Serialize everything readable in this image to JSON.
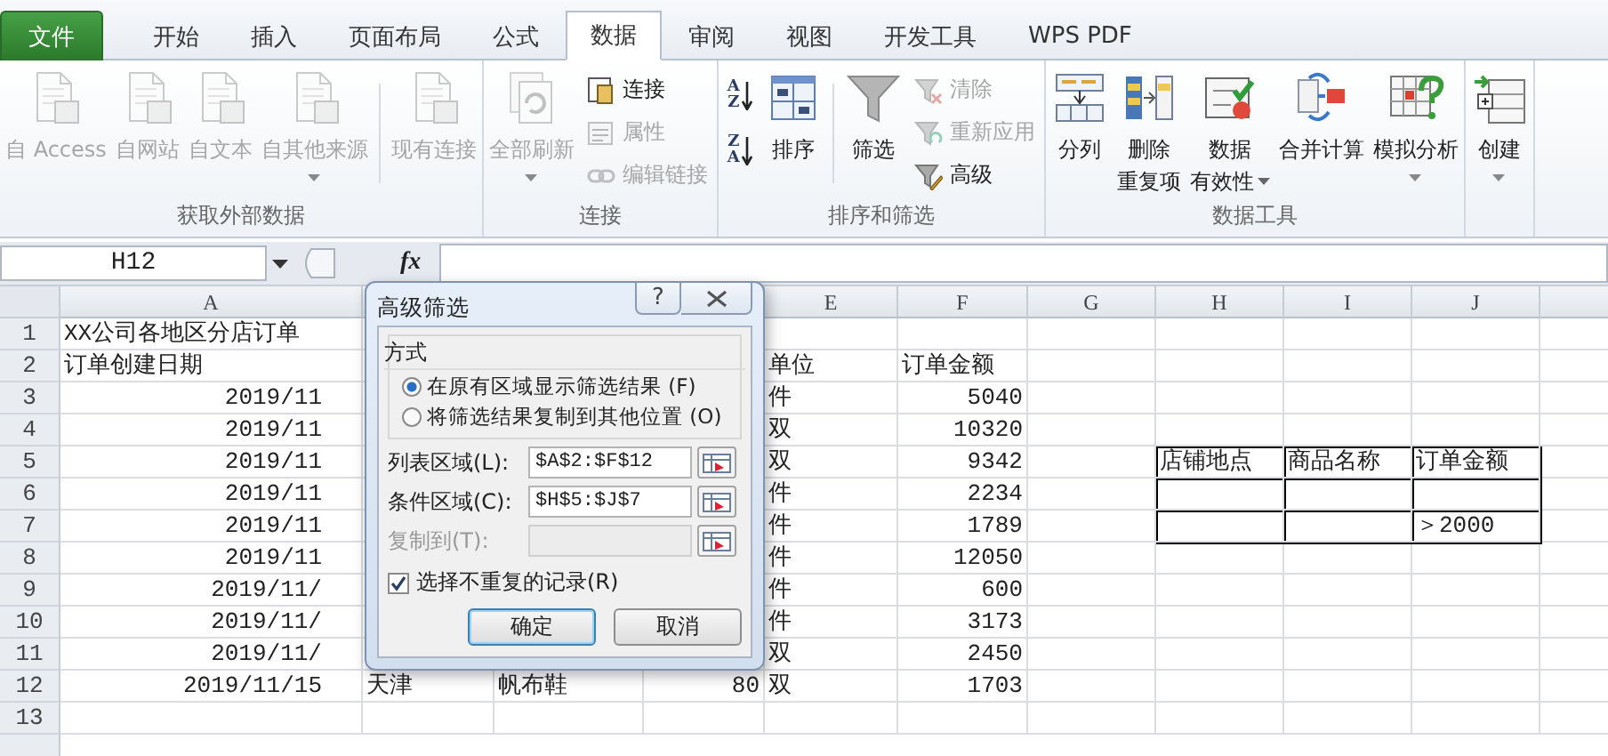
{
  "tabs": [
    {
      "label": "文件",
      "kind": "file",
      "selected": false
    },
    {
      "label": "开始",
      "kind": "tab",
      "selected": false
    },
    {
      "label": "插入",
      "kind": "tab",
      "selected": false
    },
    {
      "label": "页面布局",
      "kind": "tab",
      "selected": false
    },
    {
      "label": "公式",
      "kind": "tab",
      "selected": false
    },
    {
      "label": "数据",
      "kind": "tab",
      "selected": true
    },
    {
      "label": "审阅",
      "kind": "tab",
      "selected": false
    },
    {
      "label": "视图",
      "kind": "tab",
      "selected": false
    },
    {
      "label": "开发工具",
      "kind": "tab",
      "selected": false
    },
    {
      "label": "WPS PDF",
      "kind": "tab",
      "selected": false
    }
  ],
  "ribbon": {
    "groups": [
      {
        "title": "获取外部数据",
        "columns": [
          {
            "kind": "large",
            "lines": [
              "自 Access"
            ],
            "disabled": true,
            "dropdown": false
          },
          {
            "kind": "large",
            "lines": [
              "自网站"
            ],
            "disabled": true,
            "dropdown": false
          },
          {
            "kind": "large",
            "lines": [
              "自文本"
            ],
            "disabled": true,
            "dropdown": false
          },
          {
            "kind": "large",
            "lines": [
              "自其他来源"
            ],
            "disabled": true,
            "dropdown": true
          },
          {
            "kind": "separator"
          },
          {
            "kind": "large",
            "lines": [
              "现有连接"
            ],
            "disabled": true,
            "dropdown": false
          }
        ]
      },
      {
        "title": "连接",
        "columns": [
          {
            "kind": "large",
            "lines": [
              "全部刷新"
            ],
            "disabled": true,
            "dropdown": true
          },
          {
            "kind": "stack",
            "items": [
              {
                "label": "连接",
                "disabled": false
              },
              {
                "label": "属性",
                "disabled": true
              },
              {
                "label": "编辑链接",
                "disabled": true
              }
            ]
          }
        ]
      },
      {
        "title": "排序和筛选",
        "columns": [
          {
            "kind": "sort",
            "items": [
              {
                "top": "A",
                "bottom": "Z"
              },
              {
                "top": "Z",
                "bottom": "A"
              }
            ]
          },
          {
            "kind": "large",
            "lines": [
              "排序"
            ],
            "disabled": false,
            "dropdown": false
          },
          {
            "kind": "separator"
          },
          {
            "kind": "large",
            "lines": [
              "筛选"
            ],
            "disabled": false,
            "dropdown": false
          },
          {
            "kind": "stack",
            "items": [
              {
                "label": "清除",
                "disabled": true
              },
              {
                "label": "重新应用",
                "disabled": true
              },
              {
                "label": "高级",
                "disabled": false
              }
            ]
          }
        ]
      },
      {
        "title": "数据工具",
        "columns": [
          {
            "kind": "large",
            "lines": [
              "分列"
            ],
            "disabled": false,
            "dropdown": false
          },
          {
            "kind": "large",
            "lines": [
              "删除",
              "重复项"
            ],
            "disabled": false,
            "dropdown": false
          },
          {
            "kind": "large",
            "lines": [
              "数据",
              "有效性"
            ],
            "disabled": false,
            "dropdown": true
          },
          {
            "kind": "large",
            "lines": [
              "合并计算"
            ],
            "disabled": false,
            "dropdown": false
          },
          {
            "kind": "large",
            "lines": [
              "模拟分析"
            ],
            "disabled": false,
            "dropdown": true
          }
        ]
      },
      {
        "columns": [
          {
            "kind": "large",
            "lines": [
              "创建"
            ],
            "disabled": false,
            "dropdown": true
          }
        ]
      }
    ]
  },
  "formula_bar": {
    "name_box": "H12",
    "function_label": "fx"
  },
  "sheet": {
    "columns": [
      {
        "label": "A"
      },
      {},
      {},
      {},
      {
        "label": "E"
      },
      {
        "label": "F"
      },
      {
        "label": "G"
      },
      {
        "label": "H"
      },
      {
        "label": "I"
      },
      {
        "label": "J"
      }
    ],
    "rows": [
      {
        "number": "1",
        "cells": [
          {
            "text": "XX公司各地区分店订单"
          },
          null,
          null,
          null,
          null,
          null,
          null,
          null,
          null,
          null
        ]
      },
      {
        "number": "2",
        "cells": [
          {
            "text": "订单创建日期"
          },
          null,
          null,
          null,
          {
            "text": "单位"
          },
          {
            "text": "订单金额"
          },
          null,
          null,
          null,
          null
        ]
      },
      {
        "number": "3",
        "cells": [
          {
            "text": "2019/11",
            "right_aligned": true
          },
          null,
          null,
          null,
          {
            "text": "件"
          },
          {
            "text": "5040",
            "right_aligned": true
          },
          null,
          null,
          null,
          null
        ]
      },
      {
        "number": "4",
        "cells": [
          {
            "text": "2019/11",
            "right_aligned": true
          },
          null,
          null,
          null,
          {
            "text": "双"
          },
          {
            "text": "10320",
            "right_aligned": true
          },
          null,
          null,
          null,
          null
        ]
      },
      {
        "number": "5",
        "cells": [
          {
            "text": "2019/11",
            "right_aligned": true
          },
          null,
          null,
          null,
          {
            "text": "双"
          },
          {
            "text": "9342",
            "right_aligned": true
          },
          null,
          {
            "text": "店铺地点",
            "bordered": true
          },
          {
            "text": "商品名称",
            "bordered": true
          },
          {
            "text": "订单金额",
            "bordered": true
          }
        ]
      },
      {
        "number": "6",
        "cells": [
          {
            "text": "2019/11",
            "right_aligned": true
          },
          null,
          null,
          null,
          {
            "text": "件"
          },
          {
            "text": "2234",
            "right_aligned": true
          },
          null,
          {
            "bordered": true
          },
          {
            "bordered": true
          },
          {
            "bordered": true
          }
        ]
      },
      {
        "number": "7",
        "cells": [
          {
            "text": "2019/11",
            "right_aligned": true
          },
          null,
          null,
          null,
          {
            "text": "件"
          },
          {
            "text": "1789",
            "right_aligned": true
          },
          null,
          {
            "bordered": true
          },
          {
            "bordered": true
          },
          {
            "text": "＞2000",
            "bordered": true
          }
        ]
      },
      {
        "number": "8",
        "cells": [
          {
            "text": "2019/11",
            "right_aligned": true
          },
          null,
          null,
          null,
          {
            "text": "件"
          },
          {
            "text": "12050",
            "right_aligned": true
          },
          null,
          null,
          null,
          null
        ]
      },
      {
        "number": "9",
        "cells": [
          {
            "text": "2019/11/",
            "right_aligned": true
          },
          null,
          null,
          null,
          {
            "text": "件"
          },
          {
            "text": "600",
            "right_aligned": true
          },
          null,
          null,
          null,
          null
        ]
      },
      {
        "number": "10",
        "cells": [
          {
            "text": "2019/11/",
            "right_aligned": true
          },
          null,
          null,
          null,
          {
            "text": "件"
          },
          {
            "text": "3173",
            "right_aligned": true
          },
          null,
          null,
          null,
          null
        ]
      },
      {
        "number": "11",
        "cells": [
          {
            "text": "2019/11/",
            "right_aligned": true
          },
          null,
          null,
          null,
          {
            "text": "双"
          },
          {
            "text": "2450",
            "right_aligned": true
          },
          null,
          null,
          null,
          null
        ]
      },
      {
        "number": "12",
        "cells": [
          {
            "text": "2019/11/15",
            "right_aligned": true
          },
          {
            "text": "天津"
          },
          {
            "text": "帆布鞋"
          },
          {
            "text": "80",
            "right_aligned": true
          },
          {
            "text": "双"
          },
          {
            "text": "1703",
            "right_aligned": true
          },
          null,
          null,
          null,
          null
        ]
      },
      {
        "number": "13",
        "cells": [
          null,
          null,
          null,
          null,
          null,
          null,
          null,
          null,
          null,
          null
        ]
      }
    ]
  },
  "dialog": {
    "title": "高级筛选",
    "help": "?",
    "section": "方式",
    "options": [
      {
        "label": "在原有区域显示筛选结果 (F)",
        "selected": true
      },
      {
        "label": "将筛选结果复制到其他位置 (O)",
        "selected": false
      }
    ],
    "fields": [
      {
        "label": "列表区域(L):",
        "value": "$A$2:$F$12",
        "disabled": false
      },
      {
        "label": "条件区域(C):",
        "value": "$H$5:$J$7",
        "disabled": false
      },
      {
        "label": "复制到(T):",
        "disabled": true
      }
    ],
    "unique": {
      "label": "选择不重复的记录(R)",
      "checked": true
    },
    "buttons": [
      {
        "label": "确定",
        "default": true
      },
      {
        "label": "取消",
        "default": false
      }
    ]
  }
}
